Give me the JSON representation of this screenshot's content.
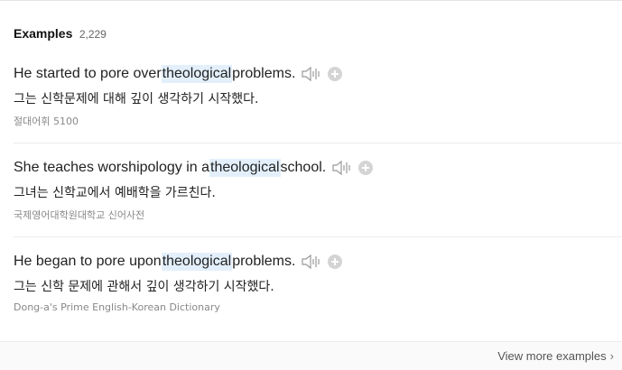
{
  "header": {
    "title": "Examples",
    "count": "2,229"
  },
  "examples": [
    {
      "before": "He started to pore over ",
      "highlight": "theological",
      "after": " problems.",
      "translation": "그는 신학문제에 대해 깊이 생각하기 시작했다.",
      "source": "절대어휘 5100"
    },
    {
      "before": "She teaches worshipology in a ",
      "highlight": "theological",
      "after": " school.",
      "translation": "그녀는 신학교에서 예배학을 가르친다.",
      "source": "국제영어대학원대학교 신어사전"
    },
    {
      "before": "He began to pore upon ",
      "highlight": "theological",
      "after": " problems.",
      "translation": "그는 신학 문제에 관해서 깊이 생각하기 시작했다.",
      "source": "Dong-a's Prime English-Korean Dictionary"
    }
  ],
  "footer": {
    "more_label": "View more examples",
    "chevron": "chevron-right-icon"
  },
  "icons": {
    "speaker": "speaker-icon",
    "add": "plus-circle-icon"
  },
  "colors": {
    "highlight": "#e3f0fc",
    "icon_gray": "#d4d4d4"
  }
}
